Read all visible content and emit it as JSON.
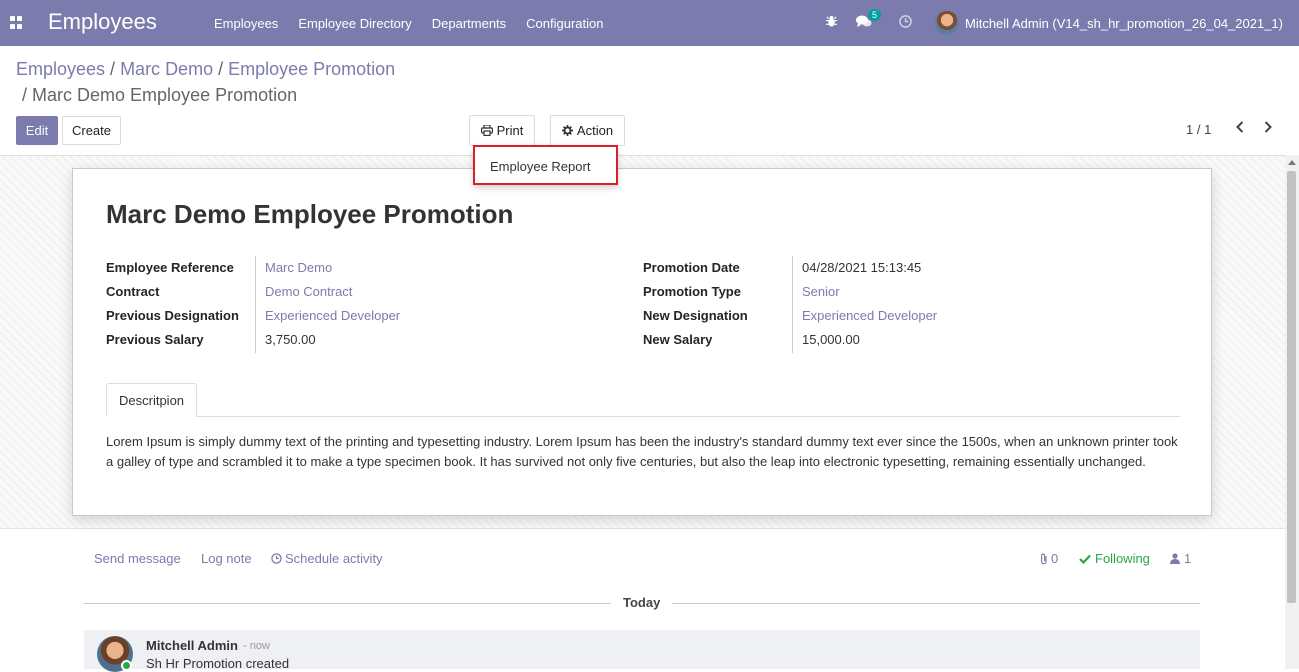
{
  "navbar": {
    "app_title": "Employees",
    "menu": [
      "Employees",
      "Employee Directory",
      "Departments",
      "Configuration"
    ],
    "messages_count": "5",
    "user_name": "Mitchell Admin (V14_sh_hr_promotion_26_04_2021_1)",
    "accent_color": "#7c7bad"
  },
  "breadcrumb": {
    "items": [
      "Employees",
      "Marc Demo",
      "Employee Promotion"
    ],
    "current": "Marc Demo Employee Promotion",
    "separator": "/"
  },
  "controls": {
    "edit_label": "Edit",
    "create_label": "Create",
    "print_label": "Print",
    "action_label": "Action",
    "pager": "1 / 1"
  },
  "print_menu": {
    "items": [
      "Employee Report"
    ]
  },
  "record": {
    "title": "Marc Demo Employee Promotion",
    "left_fields": [
      {
        "label": "Employee Reference",
        "value": "Marc Demo"
      },
      {
        "label": "Contract",
        "value": "Demo Contract"
      },
      {
        "label": "Previous Designation",
        "value": "Experienced Developer"
      },
      {
        "label": "Previous Salary",
        "value": "3,750.00"
      }
    ],
    "right_fields": [
      {
        "label": "Promotion Date",
        "value": "04/28/2021 15:13:45"
      },
      {
        "label": "Promotion Type",
        "value": "Senior"
      },
      {
        "label": "New Designation",
        "value": "Experienced Developer"
      },
      {
        "label": "New Salary",
        "value": "15,000.00"
      }
    ],
    "tab_label": "Descritpion",
    "description": "Lorem Ipsum is simply dummy text of the printing and typesetting industry. Lorem Ipsum has been the industry's standard dummy text ever since the 1500s, when an unknown printer took a galley of type and scrambled it to make a type specimen book. It has survived not only five centuries, but also the leap into electronic typesetting, remaining essentially unchanged."
  },
  "chatter": {
    "send_message": "Send message",
    "log_note": "Log note",
    "schedule_activity": "Schedule activity",
    "attachments_count": "0",
    "following_label": "Following",
    "followers_count": "1",
    "date_separator": "Today",
    "message": {
      "author": "Mitchell Admin",
      "date": "- now",
      "body": "Sh Hr Promotion created"
    }
  }
}
